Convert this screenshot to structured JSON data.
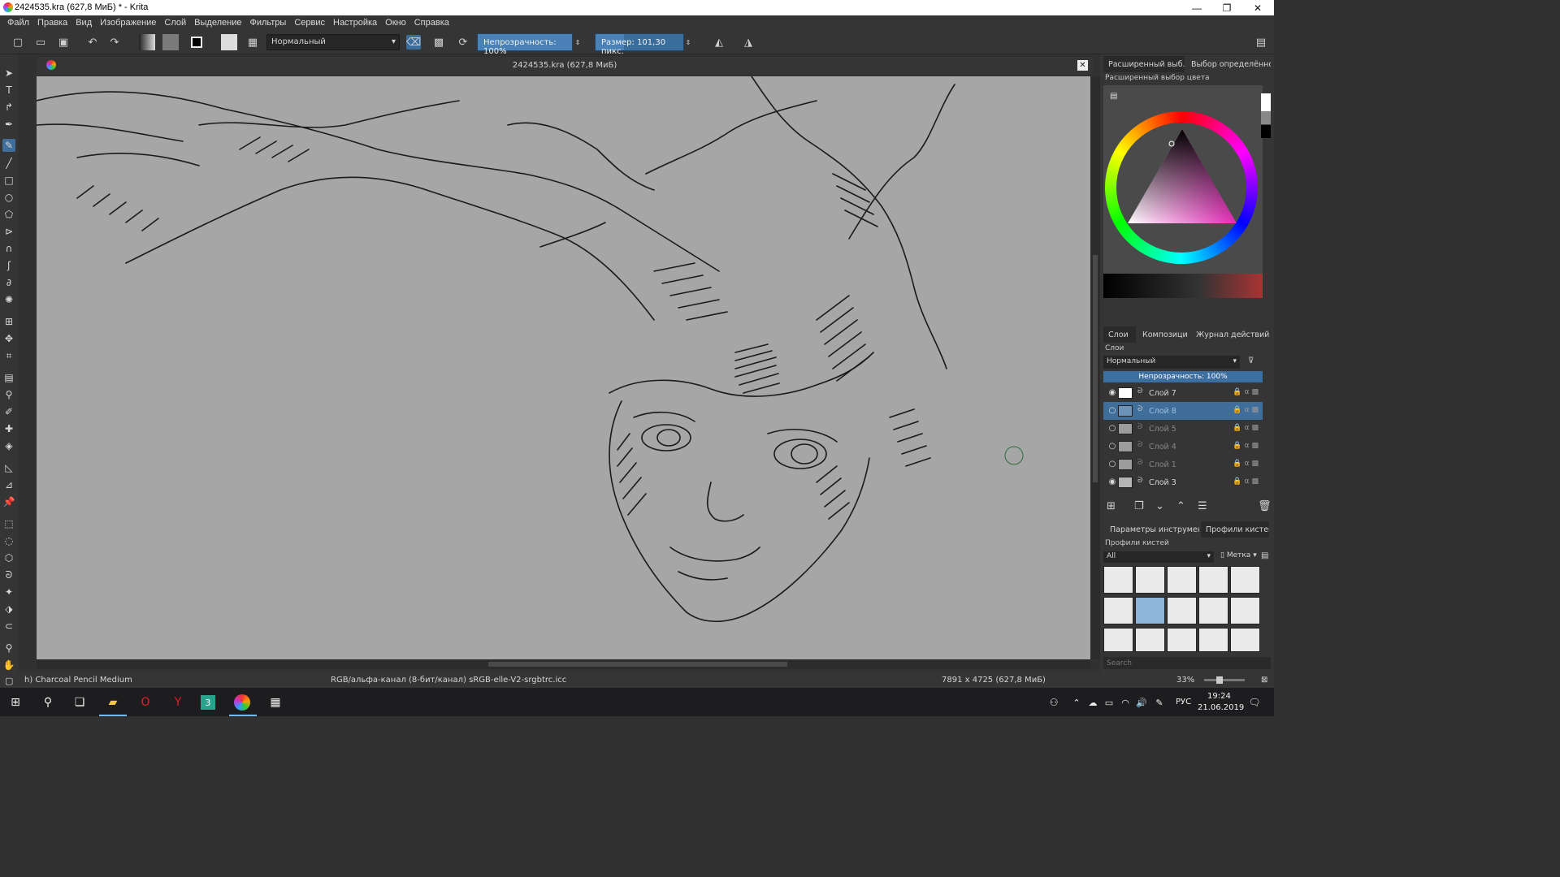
{
  "window": {
    "title": "2424535.kra (627,8 МиБ) * - Krita",
    "controls": [
      "—",
      "❐",
      "✕"
    ]
  },
  "menu": [
    "Файл",
    "Правка",
    "Вид",
    "Изображение",
    "Слой",
    "Выделение",
    "Фильтры",
    "Сервис",
    "Настройка",
    "Окно",
    "Справка"
  ],
  "toolbar": {
    "blend_mode": "Нормальный",
    "opacity_label": "Непрозрачность:  100%",
    "opacity_value": 1.0,
    "size_label": "Размер:  101,30 пикс.",
    "size_fill": 0.32
  },
  "canvas": {
    "tab_title": "2424535.kra (627,8 МиБ)",
    "bg_color": "#a6a6a6"
  },
  "dock": {
    "top_tabs": [
      "Расширенный выб...",
      "Выбор определённо..."
    ],
    "color_selector_label": "Расширенный выбор цвета",
    "layers_tabs": [
      "Слои",
      "Композиции",
      "Журнал действий"
    ],
    "layers_label": "Слои",
    "layer_blend_mode": "Нормальный",
    "layer_opacity": "Непрозрачность:  100%",
    "layers": [
      {
        "name": "Слой 7",
        "visible": true,
        "selected": false
      },
      {
        "name": "Слой 8",
        "visible": false,
        "selected": true
      },
      {
        "name": "Слой 5",
        "visible": false,
        "selected": false
      },
      {
        "name": "Слой 4",
        "visible": false,
        "selected": false
      },
      {
        "name": "Слой 1",
        "visible": false,
        "selected": false
      },
      {
        "name": "Слой 3",
        "visible": true,
        "selected": false
      }
    ],
    "bottom_tabs": [
      "Параметры инструмента",
      "Профили кистей"
    ],
    "presets_label": "Профили кистей",
    "presets_filter": "All",
    "presets_tag": "Метка",
    "search_placeholder": "Search"
  },
  "status": {
    "brush_name": "h) Charcoal Pencil Medium",
    "color_space": "RGB/альфа-канал (8-бит/канал)  sRGB-elle-V2-srgbtrc.icc",
    "dimensions": "7891 x 4725 (627,8 МиБ)",
    "zoom": "33%"
  },
  "taskbar": {
    "lang": "РУС",
    "time": "19:24",
    "date": "21.06.2019"
  }
}
